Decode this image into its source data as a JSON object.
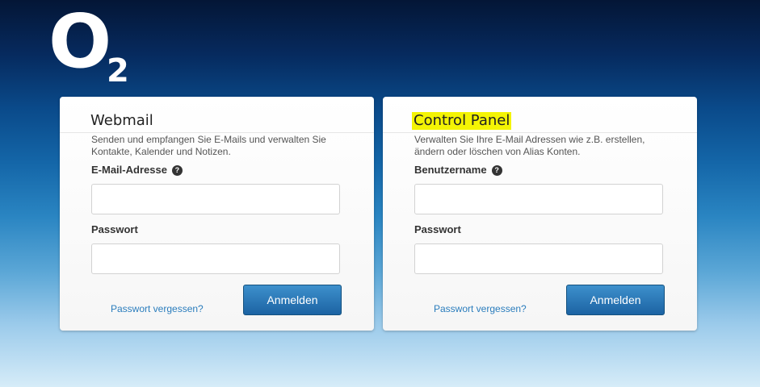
{
  "logo": {
    "letter": "O",
    "subscript": "2"
  },
  "webmail": {
    "title": "Webmail",
    "description": "Senden und empfangen Sie E-Mails und verwalten Sie Kontakte, Kalender und Notizen.",
    "field1_label": "E-Mail-Adresse",
    "field1_value": "",
    "field2_label": "Passwort",
    "field2_value": "",
    "forgot_link": "Passwort vergessen?",
    "submit_label": "Anmelden"
  },
  "control_panel": {
    "title": "Control Panel",
    "description": "Verwalten Sie Ihre E-Mail Adressen wie z.B. erstellen, ändern oder löschen von Alias Konten.",
    "field1_label": "Benutzername",
    "field1_value": "",
    "field2_label": "Passwort",
    "field2_value": "",
    "forgot_link": "Passwort vergessen?",
    "submit_label": "Anmelden"
  },
  "help_icon_glyph": "?",
  "colors": {
    "title_highlight": "#f4f404",
    "link": "#2b7dbd",
    "button": "#1c63a3"
  }
}
